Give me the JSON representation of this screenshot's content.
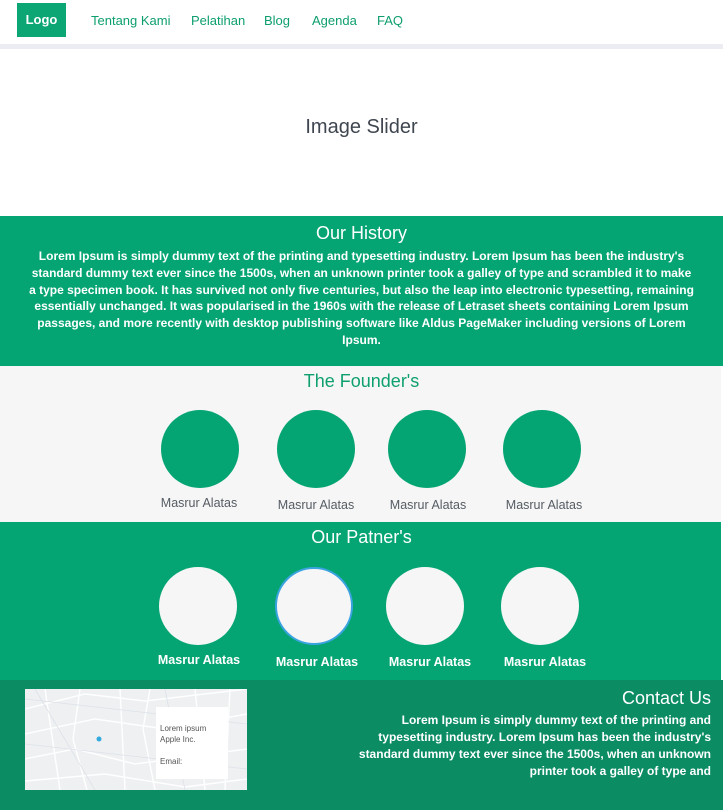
{
  "nav": {
    "logo": "Logo",
    "links": [
      "Tentang Kami",
      "Pelatihan",
      "Blog",
      "Agenda",
      "FAQ"
    ]
  },
  "slider": {
    "title": "Image Slider"
  },
  "history": {
    "title": "Our History",
    "text": "Lorem Ipsum is simply dummy text of the printing and typesetting industry. Lorem Ipsum has been the industry's standard dummy text ever since the 1500s, when an unknown printer took a galley of type and scrambled it to make a type specimen book. It has survived not only five centuries, but also the leap into electronic typesetting, remaining essentially unchanged. It was popularised in the 1960s with the release of Letraset sheets containing Lorem Ipsum passages, and more recently with desktop publishing software like Aldus PageMaker including versions of Lorem Ipsum."
  },
  "founders": {
    "title": "The Founder's",
    "people": [
      "Masrur Alatas",
      "Masrur Alatas",
      "Masrur Alatas",
      "Masrur Alatas"
    ]
  },
  "partners": {
    "title": "Our Patner's",
    "people": [
      "Masrur Alatas",
      "Masrur Alatas",
      "Masrur Alatas",
      "Masrur Alatas"
    ]
  },
  "contact": {
    "title": "Contact Us",
    "text": "Lorem Ipsum is simply dummy text of the printing and typesetting industry. Lorem Ipsum has been the industry's standard dummy text ever since the 1500s, when an unknown printer took a galley of type and",
    "map_card": [
      "Lorem ipsum",
      "Apple Inc.",
      "Email:"
    ]
  },
  "colors": {
    "primary": "#05a573",
    "dark_green": "#0b8c63",
    "light_bg": "#f6f6f6",
    "highlight_border": "#3aa3e0"
  }
}
